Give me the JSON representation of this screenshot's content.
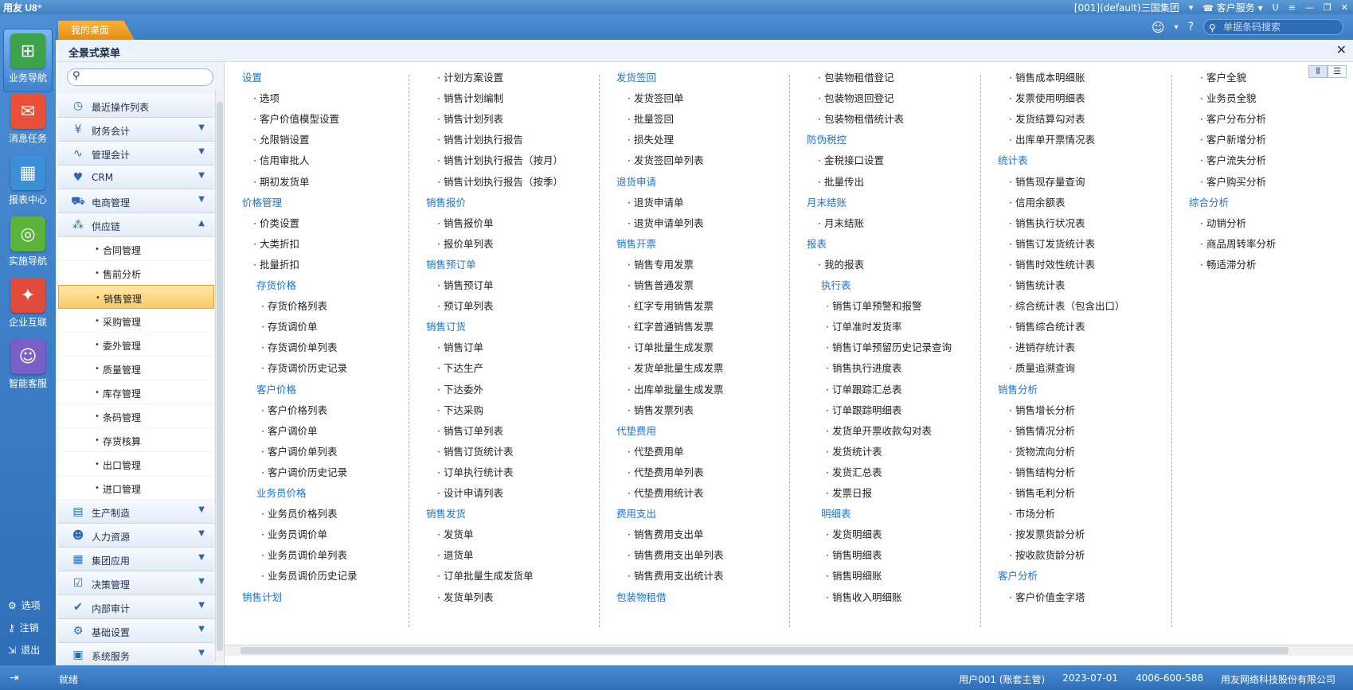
{
  "titlebar": {
    "logo": "用友 U8⁺",
    "account": "[001](default)三国集团",
    "service": "客户服务"
  },
  "tabs": {
    "desktop": "我的桌面",
    "search_placeholder": "单据条码搜索"
  },
  "left_nav": [
    {
      "label": "业务导航",
      "icon": "business-nav-icon",
      "color": "#3da34b"
    },
    {
      "label": "消息任务",
      "icon": "message-task-icon",
      "color": "#e8503a"
    },
    {
      "label": "报表中心",
      "icon": "report-center-icon",
      "color": "#3a8fd8"
    },
    {
      "label": "实施导航",
      "icon": "implementation-nav-icon",
      "color": "#5bb33a"
    },
    {
      "label": "企业互联",
      "icon": "enterprise-link-icon",
      "color": "#e04b3c"
    },
    {
      "label": "智能客服",
      "icon": "smart-service-icon",
      "color": "#7b5fc8"
    }
  ],
  "side_options": [
    {
      "label": "选项",
      "icon": "gear-icon"
    },
    {
      "label": "注销",
      "icon": "key-icon"
    },
    {
      "label": "退出",
      "icon": "exit-icon"
    }
  ],
  "menu": {
    "title": "全景式菜单",
    "categories_top": [
      {
        "label": "最近操作列表",
        "icon": "clock-icon",
        "glyph": "◷"
      },
      {
        "label": "财务会计",
        "icon": "yen-icon",
        "glyph": "¥"
      },
      {
        "label": "管理会计",
        "icon": "chart-icon",
        "glyph": "∿"
      },
      {
        "label": "CRM",
        "icon": "crm-icon",
        "glyph": "♥"
      },
      {
        "label": "电商管理",
        "icon": "cart-icon",
        "glyph": "⛟"
      },
      {
        "label": "供应链",
        "icon": "supply-chain-icon",
        "glyph": "⁂"
      }
    ],
    "subitems": [
      "合同管理",
      "售前分析",
      "销售管理",
      "采购管理",
      "委外管理",
      "质量管理",
      "库存管理",
      "条码管理",
      "存货核算",
      "出口管理",
      "进口管理"
    ],
    "selected": "销售管理",
    "categories_bottom": [
      {
        "label": "生产制造",
        "icon": "factory-icon",
        "glyph": "▤"
      },
      {
        "label": "人力资源",
        "icon": "person-icon",
        "glyph": "☻"
      },
      {
        "label": "集团应用",
        "icon": "grid-icon",
        "glyph": "▦"
      },
      {
        "label": "决策管理",
        "icon": "decision-icon",
        "glyph": "☑"
      },
      {
        "label": "内部审计",
        "icon": "audit-icon",
        "glyph": "✔"
      },
      {
        "label": "基础设置",
        "icon": "settings-icon",
        "glyph": "⚙"
      },
      {
        "label": "系统服务",
        "icon": "system-service-icon",
        "glyph": "▣"
      }
    ]
  },
  "columns": [
    [
      {
        "t": "h",
        "v": "设置"
      },
      {
        "t": "i",
        "v": "选项"
      },
      {
        "t": "i",
        "v": "客户价值模型设置"
      },
      {
        "t": "i",
        "v": "允限销设置"
      },
      {
        "t": "i",
        "v": "信用审批人"
      },
      {
        "t": "i",
        "v": "期初发货单"
      },
      {
        "t": "h",
        "v": "价格管理"
      },
      {
        "t": "i",
        "v": "价类设置"
      },
      {
        "t": "i",
        "v": "大类折扣"
      },
      {
        "t": "i",
        "v": "批量折扣"
      },
      {
        "t": "s",
        "v": "存货价格"
      },
      {
        "t": "j",
        "v": "存货价格列表"
      },
      {
        "t": "j",
        "v": "存货调价单"
      },
      {
        "t": "j",
        "v": "存货调价单列表"
      },
      {
        "t": "j",
        "v": "存货调价历史记录"
      },
      {
        "t": "s",
        "v": "客户价格"
      },
      {
        "t": "j",
        "v": "客户价格列表"
      },
      {
        "t": "j",
        "v": "客户调价单"
      },
      {
        "t": "j",
        "v": "客户调价单列表"
      },
      {
        "t": "j",
        "v": "客户调价历史记录"
      },
      {
        "t": "s",
        "v": "业务员价格"
      },
      {
        "t": "j",
        "v": "业务员价格列表"
      },
      {
        "t": "j",
        "v": "业务员调价单"
      },
      {
        "t": "j",
        "v": "业务员调价单列表"
      },
      {
        "t": "j",
        "v": "业务员调价历史记录"
      },
      {
        "t": "h",
        "v": "销售计划"
      }
    ],
    [
      {
        "t": "i",
        "v": "计划方案设置"
      },
      {
        "t": "i",
        "v": "销售计划编制"
      },
      {
        "t": "i",
        "v": "销售计划列表"
      },
      {
        "t": "i",
        "v": "销售计划执行报告"
      },
      {
        "t": "i",
        "v": "销售计划执行报告（按月）"
      },
      {
        "t": "i",
        "v": "销售计划执行报告（按季）"
      },
      {
        "t": "h",
        "v": "销售报价"
      },
      {
        "t": "i",
        "v": "销售报价单"
      },
      {
        "t": "i",
        "v": "报价单列表"
      },
      {
        "t": "h",
        "v": "销售预订单"
      },
      {
        "t": "i",
        "v": "销售预订单"
      },
      {
        "t": "i",
        "v": "预订单列表"
      },
      {
        "t": "h",
        "v": "销售订货"
      },
      {
        "t": "i",
        "v": "销售订单"
      },
      {
        "t": "i",
        "v": "下达生产"
      },
      {
        "t": "i",
        "v": "下达委外"
      },
      {
        "t": "i",
        "v": "下达采购"
      },
      {
        "t": "i",
        "v": "销售订单列表"
      },
      {
        "t": "i",
        "v": "销售订货统计表"
      },
      {
        "t": "i",
        "v": "订单执行统计表"
      },
      {
        "t": "i",
        "v": "设计申请列表"
      },
      {
        "t": "h",
        "v": "销售发货"
      },
      {
        "t": "i",
        "v": "发货单"
      },
      {
        "t": "i",
        "v": "退货单"
      },
      {
        "t": "i",
        "v": "订单批量生成发货单"
      },
      {
        "t": "i",
        "v": "发货单列表"
      }
    ],
    [
      {
        "t": "h",
        "v": "发货签回"
      },
      {
        "t": "i",
        "v": "发货签回单"
      },
      {
        "t": "i",
        "v": "批量签回"
      },
      {
        "t": "i",
        "v": "损失处理"
      },
      {
        "t": "i",
        "v": "发货签回单列表"
      },
      {
        "t": "h",
        "v": "退货申请"
      },
      {
        "t": "i",
        "v": "退货申请单"
      },
      {
        "t": "i",
        "v": "退货申请单列表"
      },
      {
        "t": "h",
        "v": "销售开票"
      },
      {
        "t": "i",
        "v": "销售专用发票"
      },
      {
        "t": "i",
        "v": "销售普通发票"
      },
      {
        "t": "i",
        "v": "红字专用销售发票"
      },
      {
        "t": "i",
        "v": "红字普通销售发票"
      },
      {
        "t": "i",
        "v": "订单批量生成发票"
      },
      {
        "t": "i",
        "v": "发货单批量生成发票"
      },
      {
        "t": "i",
        "v": "出库单批量生成发票"
      },
      {
        "t": "i",
        "v": "销售发票列表"
      },
      {
        "t": "h",
        "v": "代垫费用"
      },
      {
        "t": "i",
        "v": "代垫费用单"
      },
      {
        "t": "i",
        "v": "代垫费用单列表"
      },
      {
        "t": "i",
        "v": "代垫费用统计表"
      },
      {
        "t": "h",
        "v": "费用支出"
      },
      {
        "t": "i",
        "v": "销售费用支出单"
      },
      {
        "t": "i",
        "v": "销售费用支出单列表"
      },
      {
        "t": "i",
        "v": "销售费用支出统计表"
      },
      {
        "t": "h",
        "v": "包装物租借"
      }
    ],
    [
      {
        "t": "i",
        "v": "包装物租借登记"
      },
      {
        "t": "i",
        "v": "包装物退回登记"
      },
      {
        "t": "i",
        "v": "包装物租借统计表"
      },
      {
        "t": "h",
        "v": "防伪税控"
      },
      {
        "t": "i",
        "v": "金税接口设置"
      },
      {
        "t": "i",
        "v": "批量传出"
      },
      {
        "t": "h",
        "v": "月末结账"
      },
      {
        "t": "i",
        "v": "月末结账"
      },
      {
        "t": "h",
        "v": "报表"
      },
      {
        "t": "i",
        "v": "我的报表"
      },
      {
        "t": "s",
        "v": "执行表"
      },
      {
        "t": "j",
        "v": "销售订单预警和报警"
      },
      {
        "t": "j",
        "v": "订单准时发货率"
      },
      {
        "t": "j",
        "v": "销售订单预留历史记录查询"
      },
      {
        "t": "j",
        "v": "销售执行进度表"
      },
      {
        "t": "j",
        "v": "订单跟踪汇总表"
      },
      {
        "t": "j",
        "v": "订单跟踪明细表"
      },
      {
        "t": "j",
        "v": "发货单开票收款勾对表"
      },
      {
        "t": "j",
        "v": "发货统计表"
      },
      {
        "t": "j",
        "v": "发货汇总表"
      },
      {
        "t": "j",
        "v": "发票日报"
      },
      {
        "t": "s",
        "v": "明细表"
      },
      {
        "t": "j",
        "v": "发货明细表"
      },
      {
        "t": "j",
        "v": "销售明细表"
      },
      {
        "t": "j",
        "v": "销售明细账"
      },
      {
        "t": "j",
        "v": "销售收入明细账"
      }
    ],
    [
      {
        "t": "i",
        "v": "销售成本明细账"
      },
      {
        "t": "i",
        "v": "发票使用明细表"
      },
      {
        "t": "i",
        "v": "发货结算勾对表"
      },
      {
        "t": "i",
        "v": "出库单开票情况表"
      },
      {
        "t": "h",
        "v": "统计表"
      },
      {
        "t": "i",
        "v": "销售现存量查询"
      },
      {
        "t": "i",
        "v": "信用余额表"
      },
      {
        "t": "i",
        "v": "销售执行状况表"
      },
      {
        "t": "i",
        "v": "销售订发货统计表"
      },
      {
        "t": "i",
        "v": "销售时效性统计表"
      },
      {
        "t": "i",
        "v": "销售统计表"
      },
      {
        "t": "i",
        "v": "综合统计表（包含出口）"
      },
      {
        "t": "i",
        "v": "销售综合统计表"
      },
      {
        "t": "i",
        "v": "进销存统计表"
      },
      {
        "t": "i",
        "v": "质量追溯查询"
      },
      {
        "t": "h",
        "v": "销售分析"
      },
      {
        "t": "i",
        "v": "销售增长分析"
      },
      {
        "t": "i",
        "v": "销售情况分析"
      },
      {
        "t": "i",
        "v": "货物流向分析"
      },
      {
        "t": "i",
        "v": "销售结构分析"
      },
      {
        "t": "i",
        "v": "销售毛利分析"
      },
      {
        "t": "i",
        "v": "市场分析"
      },
      {
        "t": "i",
        "v": "按发票货龄分析"
      },
      {
        "t": "i",
        "v": "按收款货龄分析"
      },
      {
        "t": "h",
        "v": "客户分析"
      },
      {
        "t": "i",
        "v": "客户价值金字塔"
      }
    ],
    [
      {
        "t": "i",
        "v": "客户全貌"
      },
      {
        "t": "i",
        "v": "业务员全貌"
      },
      {
        "t": "i",
        "v": "客户分布分析"
      },
      {
        "t": "i",
        "v": "客户新增分析"
      },
      {
        "t": "i",
        "v": "客户流失分析"
      },
      {
        "t": "i",
        "v": "客户购买分析"
      },
      {
        "t": "h",
        "v": "综合分析"
      },
      {
        "t": "i",
        "v": "动销分析"
      },
      {
        "t": "i",
        "v": "商品周转率分析"
      },
      {
        "t": "i",
        "v": "畅适滞分析"
      }
    ]
  ],
  "status": {
    "ready": "就绪",
    "user": "用户001 (账套主管)",
    "date": "2023-07-01",
    "phone": "4006-600-588",
    "company": "用友网络科技股份有限公司"
  }
}
